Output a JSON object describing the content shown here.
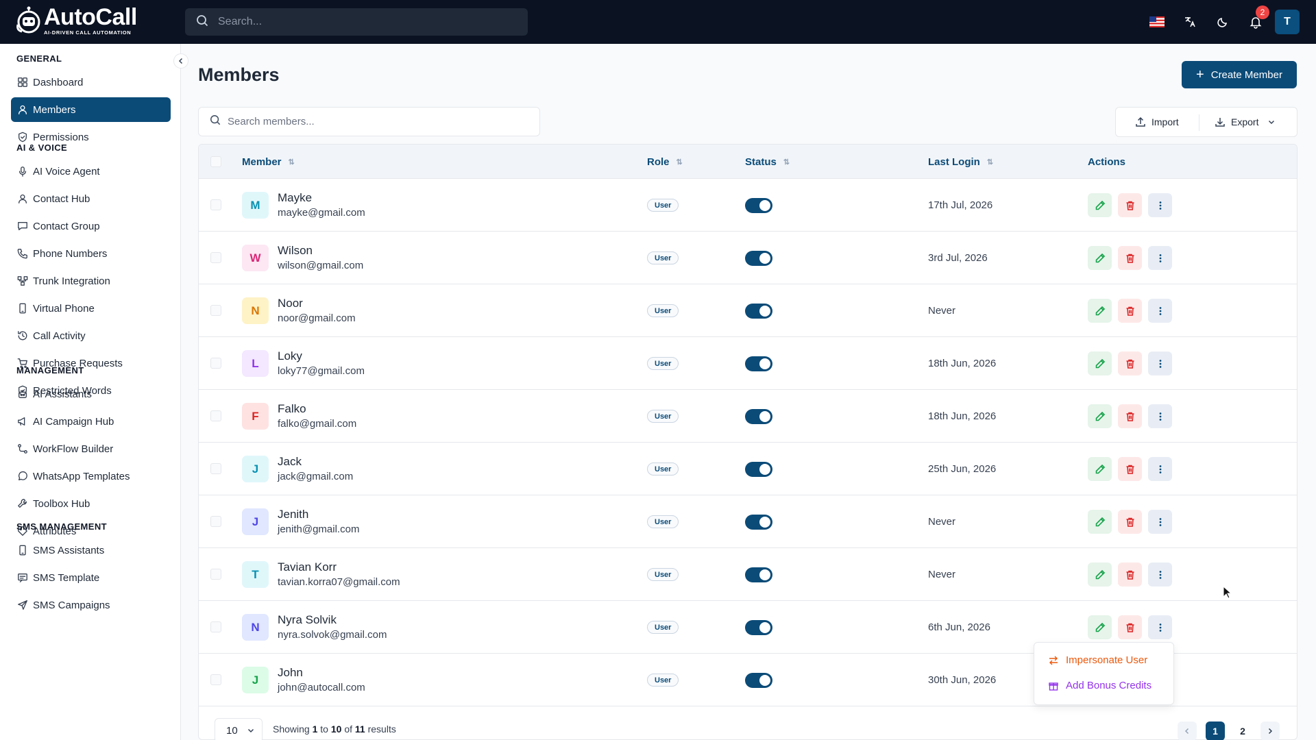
{
  "app": {
    "name": "AutoCall",
    "tagline": "AI-DRIVEN CALL AUTOMATION",
    "search_placeholder": "Search...",
    "notification_count": "2",
    "user_initial": "T"
  },
  "sidebar": {
    "sections": [
      {
        "title": "GENERAL",
        "items": [
          {
            "label": "Dashboard",
            "icon": "dashboard-icon"
          },
          {
            "label": "Members",
            "icon": "user-icon",
            "active": true
          },
          {
            "label": "Permissions",
            "icon": "shield-icon"
          }
        ]
      },
      {
        "title": "AI & VOICE",
        "items": [
          {
            "label": "AI Voice Agent",
            "icon": "mic-icon"
          },
          {
            "label": "Contact Hub",
            "icon": "user-icon"
          },
          {
            "label": "Contact Group",
            "icon": "chat-icon"
          },
          {
            "label": "Phone Numbers",
            "icon": "phone-icon"
          },
          {
            "label": "Trunk Integration",
            "icon": "network-icon"
          },
          {
            "label": "Virtual Phone",
            "icon": "mobile-icon"
          },
          {
            "label": "Call Activity",
            "icon": "history-icon"
          },
          {
            "label": "Purchase Requests",
            "icon": "cart-icon"
          },
          {
            "label": "Restricted Words",
            "icon": "shield-icon"
          }
        ]
      },
      {
        "title": "MANAGEMENT",
        "items": [
          {
            "label": "AI Assistants",
            "icon": "robot-icon"
          },
          {
            "label": "AI Campaign Hub",
            "icon": "megaphone-icon"
          },
          {
            "label": "WorkFlow Builder",
            "icon": "workflow-icon"
          },
          {
            "label": "WhatsApp Templates",
            "icon": "whatsapp-icon"
          },
          {
            "label": "Toolbox Hub",
            "icon": "wrench-icon"
          },
          {
            "label": "Attributes",
            "icon": "tag-icon"
          }
        ]
      },
      {
        "title": "SMS MANAGEMENT",
        "items": [
          {
            "label": "SMS Assistants",
            "icon": "mobile-icon"
          },
          {
            "label": "SMS Template",
            "icon": "message-icon"
          },
          {
            "label": "SMS Campaigns",
            "icon": "send-icon"
          }
        ]
      }
    ]
  },
  "page": {
    "title": "Members",
    "create_label": "Create Member",
    "search_placeholder": "Search members...",
    "import_label": "Import",
    "export_label": "Export"
  },
  "table": {
    "headers": {
      "member": "Member",
      "role": "Role",
      "status": "Status",
      "last_login": "Last Login",
      "actions": "Actions"
    },
    "rows": [
      {
        "initial": "M",
        "name": "Mayke",
        "email": "mayke@gmail.com",
        "role": "User",
        "active": true,
        "last_login": "17th Jul, 2026",
        "bg": "#e0f7fa",
        "fg": "#0891b2"
      },
      {
        "initial": "W",
        "name": "Wilson",
        "email": "wilson@gmail.com",
        "role": "User",
        "active": true,
        "last_login": "3rd Jul, 2026",
        "bg": "#fce7f3",
        "fg": "#db2777"
      },
      {
        "initial": "N",
        "name": "Noor",
        "email": "noor@gmail.com",
        "role": "User",
        "active": true,
        "last_login": "Never",
        "bg": "#fef3c7",
        "fg": "#d97706"
      },
      {
        "initial": "L",
        "name": "Loky",
        "email": "loky77@gmail.com",
        "role": "User",
        "active": true,
        "last_login": "18th Jun, 2026",
        "bg": "#f3e8ff",
        "fg": "#9333ea"
      },
      {
        "initial": "F",
        "name": "Falko",
        "email": "falko@gmail.com",
        "role": "User",
        "active": true,
        "last_login": "18th Jun, 2026",
        "bg": "#fee2e2",
        "fg": "#dc2626"
      },
      {
        "initial": "J",
        "name": "Jack",
        "email": "jack@gmail.com",
        "role": "User",
        "active": true,
        "last_login": "25th Jun, 2026",
        "bg": "#e0f7fa",
        "fg": "#0891b2"
      },
      {
        "initial": "J",
        "name": "Jenith",
        "email": "jenith@gmail.com",
        "role": "User",
        "active": true,
        "last_login": "Never",
        "bg": "#e0e7ff",
        "fg": "#4f46e5"
      },
      {
        "initial": "T",
        "name": "Tavian Korr",
        "email": "tavian.korra07@gmail.com",
        "role": "User",
        "active": true,
        "last_login": "Never",
        "bg": "#e0f7fa",
        "fg": "#0891b2"
      },
      {
        "initial": "N",
        "name": "Nyra Solvik",
        "email": "nyra.solvok@gmail.com",
        "role": "User",
        "active": true,
        "last_login": "6th Jun, 2026",
        "bg": "#e0e7ff",
        "fg": "#4f46e5"
      },
      {
        "initial": "J",
        "name": "John",
        "email": "john@autocall.com",
        "role": "User",
        "active": true,
        "last_login": "30th Jun, 2026",
        "bg": "#dcfce7",
        "fg": "#16a34a"
      }
    ]
  },
  "dropdown": {
    "impersonate_label": "Impersonate User",
    "bonus_label": "Add Bonus Credits"
  },
  "pagination": {
    "per_page": "10",
    "showing_prefix": "Showing",
    "from": "1",
    "to_word": "to",
    "to": "10",
    "of_word": "of",
    "total": "11",
    "results_word": "results",
    "pages": [
      "1",
      "2"
    ],
    "current": "1"
  },
  "colors": {
    "primary": "#0b4b78",
    "danger": "#dc2626",
    "success": "#16a34a",
    "accent_orange": "#ea580c",
    "accent_purple": "#9333ea"
  }
}
